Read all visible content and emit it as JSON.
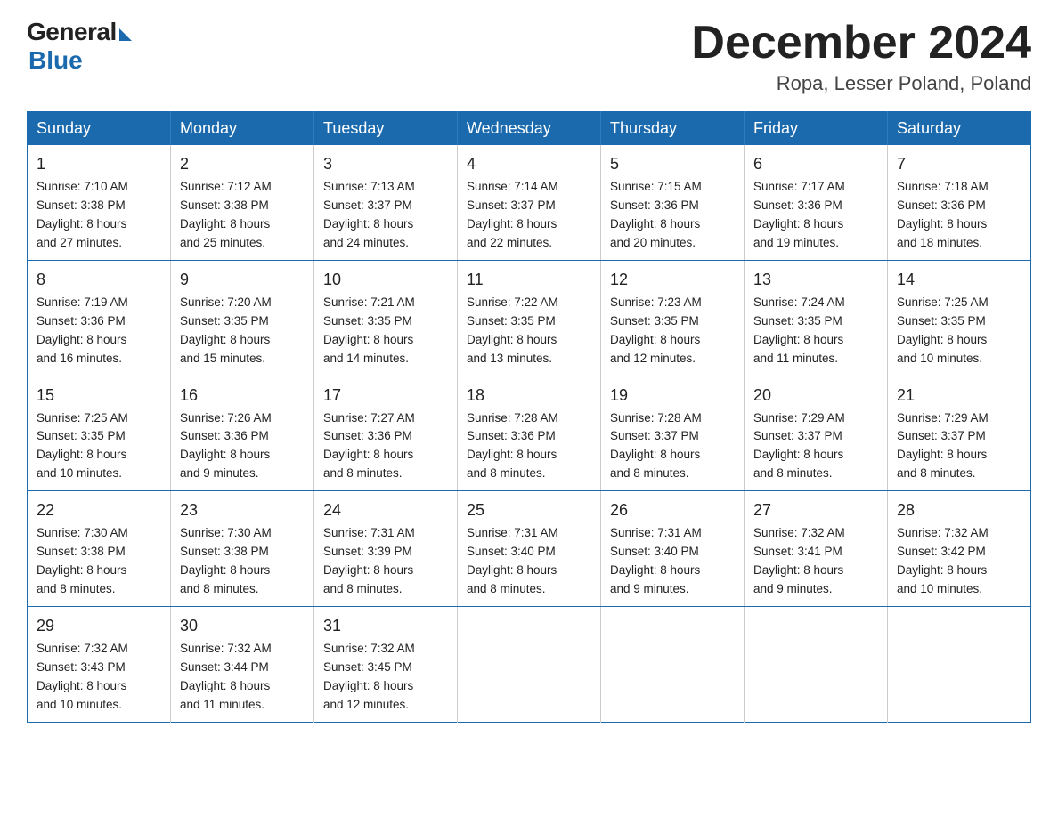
{
  "logo": {
    "general": "General",
    "blue": "Blue"
  },
  "title": "December 2024",
  "location": "Ropa, Lesser Poland, Poland",
  "days_of_week": [
    "Sunday",
    "Monday",
    "Tuesday",
    "Wednesday",
    "Thursday",
    "Friday",
    "Saturday"
  ],
  "weeks": [
    [
      {
        "day": "1",
        "sunrise": "7:10 AM",
        "sunset": "3:38 PM",
        "daylight": "8 hours and 27 minutes."
      },
      {
        "day": "2",
        "sunrise": "7:12 AM",
        "sunset": "3:38 PM",
        "daylight": "8 hours and 25 minutes."
      },
      {
        "day": "3",
        "sunrise": "7:13 AM",
        "sunset": "3:37 PM",
        "daylight": "8 hours and 24 minutes."
      },
      {
        "day": "4",
        "sunrise": "7:14 AM",
        "sunset": "3:37 PM",
        "daylight": "8 hours and 22 minutes."
      },
      {
        "day": "5",
        "sunrise": "7:15 AM",
        "sunset": "3:36 PM",
        "daylight": "8 hours and 20 minutes."
      },
      {
        "day": "6",
        "sunrise": "7:17 AM",
        "sunset": "3:36 PM",
        "daylight": "8 hours and 19 minutes."
      },
      {
        "day": "7",
        "sunrise": "7:18 AM",
        "sunset": "3:36 PM",
        "daylight": "8 hours and 18 minutes."
      }
    ],
    [
      {
        "day": "8",
        "sunrise": "7:19 AM",
        "sunset": "3:36 PM",
        "daylight": "8 hours and 16 minutes."
      },
      {
        "day": "9",
        "sunrise": "7:20 AM",
        "sunset": "3:35 PM",
        "daylight": "8 hours and 15 minutes."
      },
      {
        "day": "10",
        "sunrise": "7:21 AM",
        "sunset": "3:35 PM",
        "daylight": "8 hours and 14 minutes."
      },
      {
        "day": "11",
        "sunrise": "7:22 AM",
        "sunset": "3:35 PM",
        "daylight": "8 hours and 13 minutes."
      },
      {
        "day": "12",
        "sunrise": "7:23 AM",
        "sunset": "3:35 PM",
        "daylight": "8 hours and 12 minutes."
      },
      {
        "day": "13",
        "sunrise": "7:24 AM",
        "sunset": "3:35 PM",
        "daylight": "8 hours and 11 minutes."
      },
      {
        "day": "14",
        "sunrise": "7:25 AM",
        "sunset": "3:35 PM",
        "daylight": "8 hours and 10 minutes."
      }
    ],
    [
      {
        "day": "15",
        "sunrise": "7:25 AM",
        "sunset": "3:35 PM",
        "daylight": "8 hours and 10 minutes."
      },
      {
        "day": "16",
        "sunrise": "7:26 AM",
        "sunset": "3:36 PM",
        "daylight": "8 hours and 9 minutes."
      },
      {
        "day": "17",
        "sunrise": "7:27 AM",
        "sunset": "3:36 PM",
        "daylight": "8 hours and 8 minutes."
      },
      {
        "day": "18",
        "sunrise": "7:28 AM",
        "sunset": "3:36 PM",
        "daylight": "8 hours and 8 minutes."
      },
      {
        "day": "19",
        "sunrise": "7:28 AM",
        "sunset": "3:37 PM",
        "daylight": "8 hours and 8 minutes."
      },
      {
        "day": "20",
        "sunrise": "7:29 AM",
        "sunset": "3:37 PM",
        "daylight": "8 hours and 8 minutes."
      },
      {
        "day": "21",
        "sunrise": "7:29 AM",
        "sunset": "3:37 PM",
        "daylight": "8 hours and 8 minutes."
      }
    ],
    [
      {
        "day": "22",
        "sunrise": "7:30 AM",
        "sunset": "3:38 PM",
        "daylight": "8 hours and 8 minutes."
      },
      {
        "day": "23",
        "sunrise": "7:30 AM",
        "sunset": "3:38 PM",
        "daylight": "8 hours and 8 minutes."
      },
      {
        "day": "24",
        "sunrise": "7:31 AM",
        "sunset": "3:39 PM",
        "daylight": "8 hours and 8 minutes."
      },
      {
        "day": "25",
        "sunrise": "7:31 AM",
        "sunset": "3:40 PM",
        "daylight": "8 hours and 8 minutes."
      },
      {
        "day": "26",
        "sunrise": "7:31 AM",
        "sunset": "3:40 PM",
        "daylight": "8 hours and 9 minutes."
      },
      {
        "day": "27",
        "sunrise": "7:32 AM",
        "sunset": "3:41 PM",
        "daylight": "8 hours and 9 minutes."
      },
      {
        "day": "28",
        "sunrise": "7:32 AM",
        "sunset": "3:42 PM",
        "daylight": "8 hours and 10 minutes."
      }
    ],
    [
      {
        "day": "29",
        "sunrise": "7:32 AM",
        "sunset": "3:43 PM",
        "daylight": "8 hours and 10 minutes."
      },
      {
        "day": "30",
        "sunrise": "7:32 AM",
        "sunset": "3:44 PM",
        "daylight": "8 hours and 11 minutes."
      },
      {
        "day": "31",
        "sunrise": "7:32 AM",
        "sunset": "3:45 PM",
        "daylight": "8 hours and 12 minutes."
      },
      null,
      null,
      null,
      null
    ]
  ],
  "labels": {
    "sunrise": "Sunrise:",
    "sunset": "Sunset:",
    "daylight": "Daylight:"
  }
}
